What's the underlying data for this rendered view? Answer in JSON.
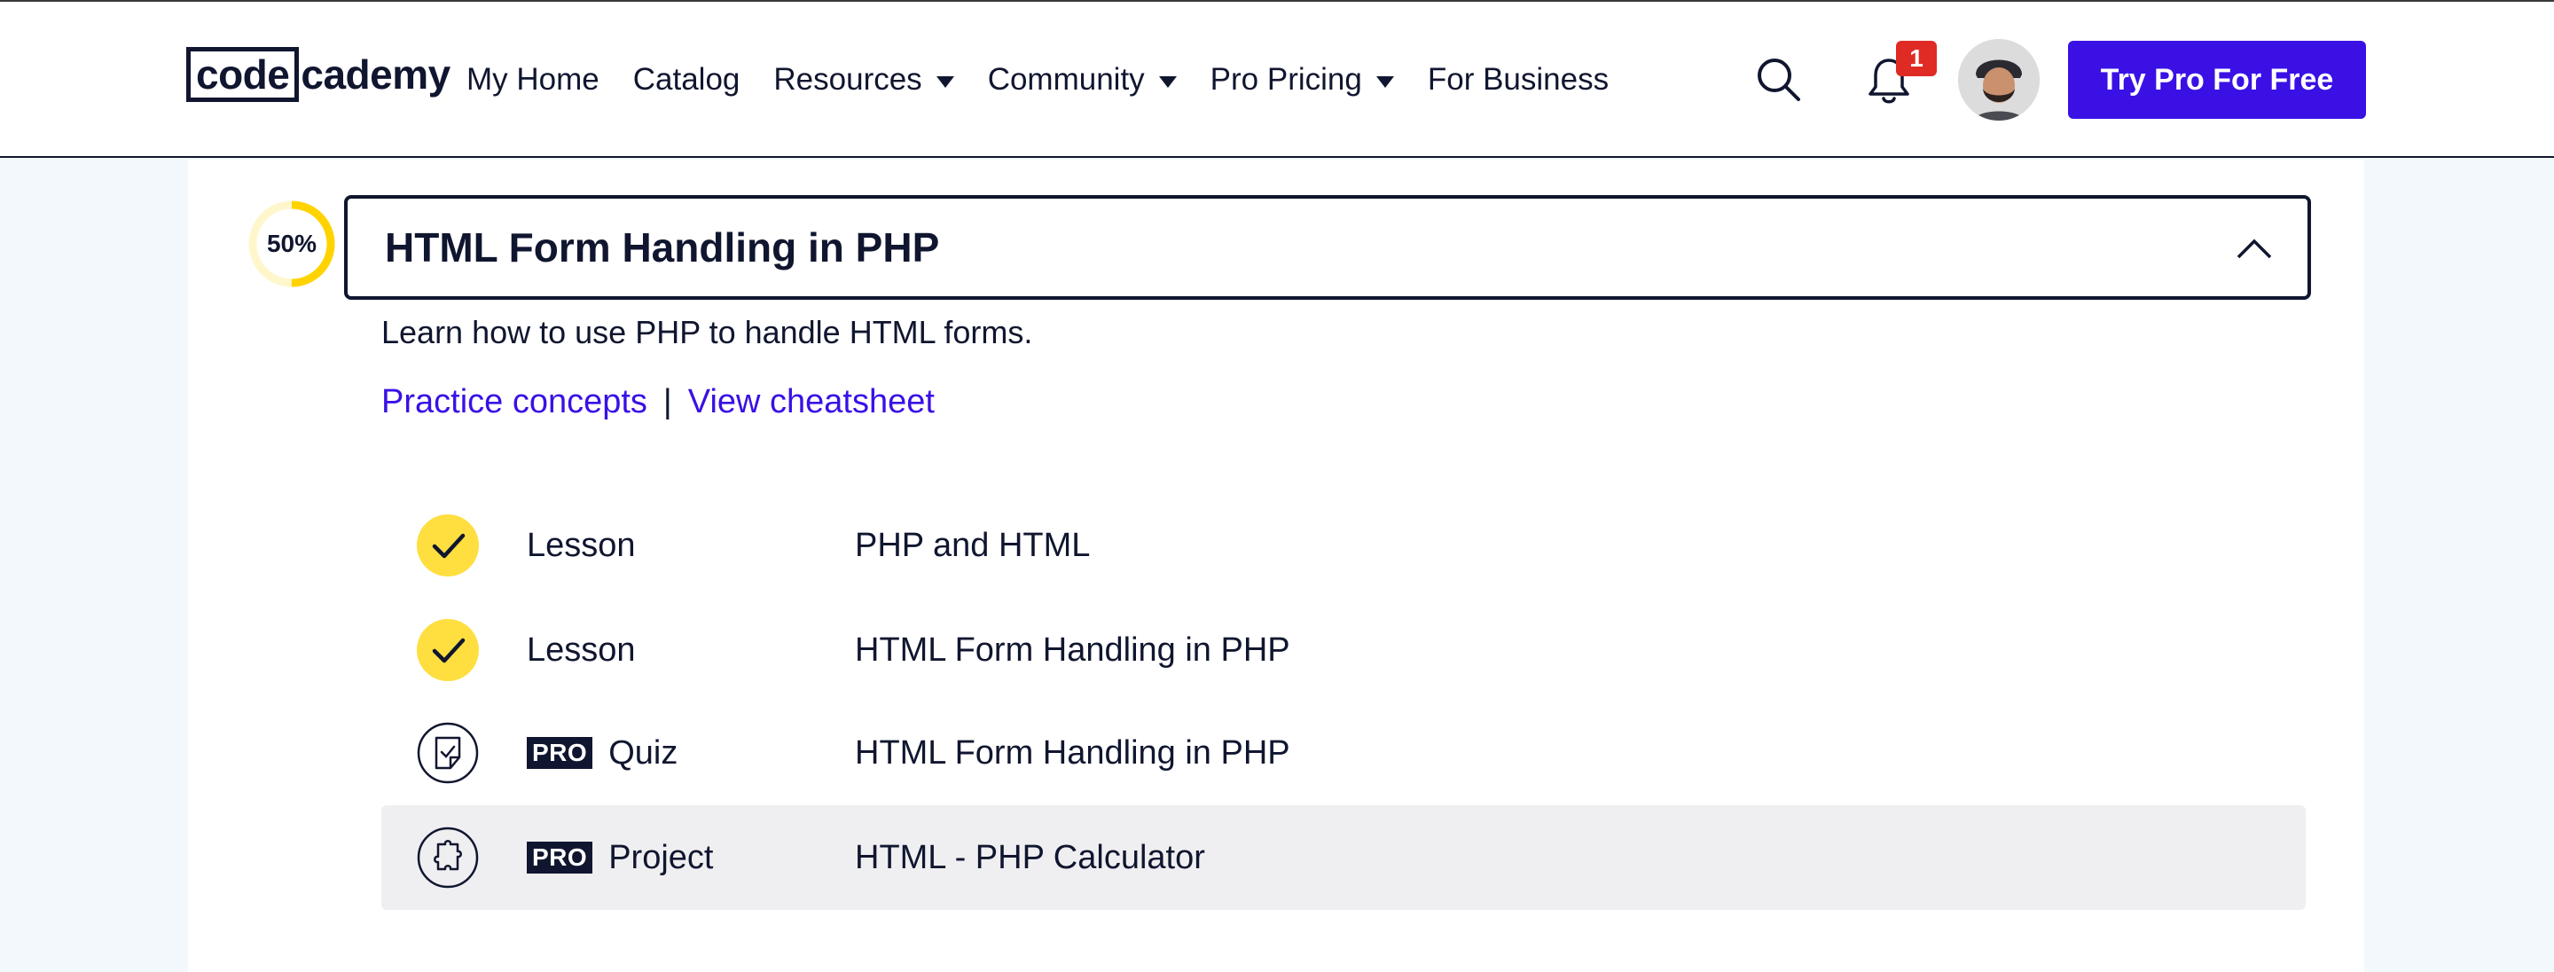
{
  "header": {
    "logo": {
      "part1": "code",
      "part2": "cademy"
    },
    "nav": [
      {
        "label": "My Home",
        "dropdown": false
      },
      {
        "label": "Catalog",
        "dropdown": false
      },
      {
        "label": "Resources",
        "dropdown": true
      },
      {
        "label": "Community",
        "dropdown": true
      },
      {
        "label": "Pro Pricing",
        "dropdown": true
      },
      {
        "label": "For Business",
        "dropdown": false
      }
    ],
    "notifications_count": "1",
    "cta_label": "Try Pro For Free"
  },
  "module": {
    "progress_percent": 50,
    "progress_label": "50%",
    "title": "HTML Form Handling in PHP",
    "description": "Learn how to use PHP to handle HTML forms.",
    "links": {
      "practice": "Practice concepts",
      "separator": "|",
      "cheatsheet": "View cheatsheet"
    },
    "items": [
      {
        "type": "Lesson",
        "title": "PHP and HTML",
        "pro": false,
        "status": "completed",
        "pro_label": ""
      },
      {
        "type": "Lesson",
        "title": "HTML Form Handling in PHP",
        "pro": false,
        "status": "completed",
        "pro_label": ""
      },
      {
        "type": "Quiz",
        "title": "HTML Form Handling in PHP",
        "pro": true,
        "status": "quiz-icon",
        "pro_label": "PRO"
      },
      {
        "type": "Project",
        "title": "HTML - PHP Calculator",
        "pro": true,
        "status": "puzzle-icon",
        "pro_label": "PRO"
      }
    ]
  },
  "colors": {
    "brand": "#3a10e5",
    "navy": "#10162f",
    "progress": "#ffd300",
    "badge": "#e02b24",
    "page_bg": "#f3f8fd"
  }
}
